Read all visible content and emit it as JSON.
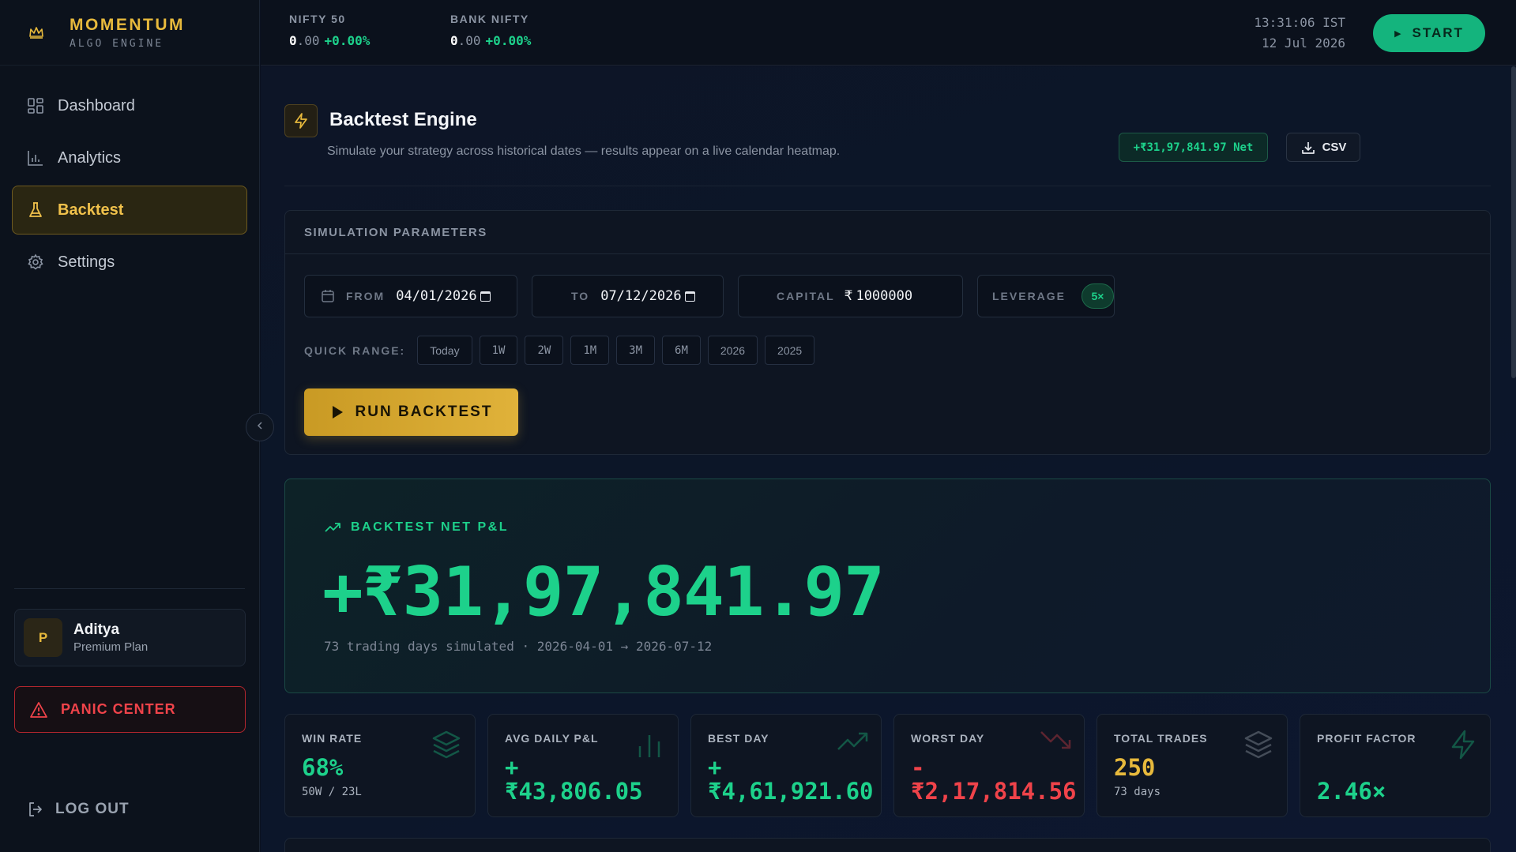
{
  "brand": {
    "title": "MOMENTUM",
    "subtitle": "ALGO ENGINE"
  },
  "nav": [
    {
      "label": "Dashboard",
      "icon": "grid-icon"
    },
    {
      "label": "Analytics",
      "icon": "bar-chart-icon"
    },
    {
      "label": "Backtest",
      "icon": "flask-icon",
      "active": true
    },
    {
      "label": "Settings",
      "icon": "gear-icon"
    }
  ],
  "user": {
    "initial": "P",
    "name": "Aditya",
    "plan": "Premium Plan"
  },
  "panic_label": "PANIC CENTER",
  "logout_label": "LOG OUT",
  "tickers": [
    {
      "name": "NIFTY 50",
      "value": "0",
      "decimals": ".00",
      "change": "+0.00%"
    },
    {
      "name": "BANK NIFTY",
      "value": "0",
      "decimals": ".00",
      "change": "+0.00%"
    }
  ],
  "clock": {
    "time": "13:31:06 IST",
    "date": "12 Jul 2026"
  },
  "start_label": "START",
  "page": {
    "title": "Backtest Engine",
    "subtitle": "Simulate your strategy across historical dates — results appear on a live calendar heatmap.",
    "net_badge": "+₹31,97,841.97 Net",
    "csv_label": "CSV"
  },
  "params": {
    "heading": "SIMULATION PARAMETERS",
    "from_label": "FROM",
    "from_value": "04/01/2026",
    "to_label": "TO",
    "to_value": "07/12/2026",
    "capital_label": "CAPITAL",
    "capital_currency": "₹",
    "capital_value": "1000000",
    "leverage_label": "LEVERAGE",
    "leverage_value": "5×",
    "quick_range_label": "QUICK RANGE:",
    "quick_ranges": [
      "Today",
      "1W",
      "2W",
      "1M",
      "3M",
      "6M",
      "2026",
      "2025"
    ],
    "run_label": "RUN BACKTEST"
  },
  "pnl": {
    "label": "BACKTEST NET P&L",
    "value": "+₹31,97,841.97",
    "summary": "73 trading days simulated · 2026-04-01 → 2026-07-12"
  },
  "stats": [
    {
      "label": "WIN RATE",
      "value": "68%",
      "sub": "50W / 23L",
      "tone": "green",
      "icon": "layers-icon"
    },
    {
      "label": "AVG DAILY P&L",
      "sign": "+",
      "value": "₹43,806.05",
      "tone": "green",
      "icon": "bar-chart-icon"
    },
    {
      "label": "BEST DAY",
      "sign": "+",
      "value": "₹4,61,921.60",
      "tone": "green",
      "icon": "trending-up-icon"
    },
    {
      "label": "WORST DAY",
      "sign": "-",
      "value": "₹2,17,814.56",
      "tone": "red",
      "icon": "trending-down-icon"
    },
    {
      "label": "TOTAL TRADES",
      "value": "250",
      "sub": "73 days",
      "tone": "gold",
      "icon": "layers-icon"
    },
    {
      "label": "PROFIT FACTOR",
      "value": "2.46×",
      "tone": "green",
      "icon": "lightning-icon"
    }
  ],
  "colors": {
    "accent_gold": "#e7b93c",
    "profit_green": "#1dd18b",
    "loss_red": "#f0434a",
    "background": "#0b1120"
  }
}
